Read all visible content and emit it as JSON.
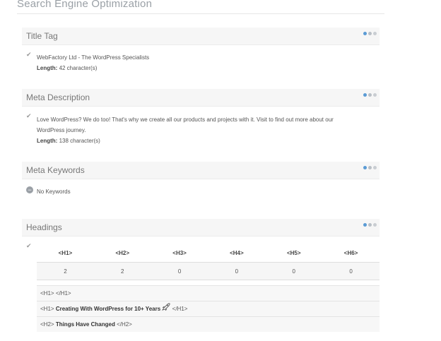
{
  "page_title": "Search Engine Optimization",
  "title_tag": {
    "heading": "Title Tag",
    "value": "WebFactory Ltd - The WordPress Specialists",
    "length_label": "Length:",
    "length_value": "42 character(s)"
  },
  "meta_description": {
    "heading": "Meta Description",
    "line1": "Love WordPress? We do too! That's why we create all our products and projects with it. Visit to find out more about our",
    "line2": "WordPress journey.",
    "length_label": "Length:",
    "length_value": "138 character(s)"
  },
  "meta_keywords": {
    "heading": "Meta Keywords",
    "value": "No Keywords"
  },
  "headings": {
    "heading": "Headings",
    "columns": [
      "<H1>",
      "<H2>",
      "<H3>",
      "<H4>",
      "<H5>",
      "<H6>"
    ],
    "counts": [
      "2",
      "2",
      "0",
      "0",
      "0",
      "0"
    ],
    "rows": [
      {
        "open": "<H1>",
        "text": "",
        "close": "</H1>"
      },
      {
        "open": "<H1>",
        "text": "Creating With WordPress for 10+ Years",
        "close": "</H1>"
      },
      {
        "open": "<H2>",
        "text": "Things Have Changed",
        "close": "</H2>"
      }
    ]
  },
  "icons": {
    "check": "check-icon",
    "minus": "minus-circle-icon",
    "rocket": "rocket-icon",
    "panel_controls": "panel-controls-icon"
  },
  "colors": {
    "accent": "#5b9bd5",
    "panel_bg": "#f6f6f6",
    "muted": "#9aa0a6"
  }
}
